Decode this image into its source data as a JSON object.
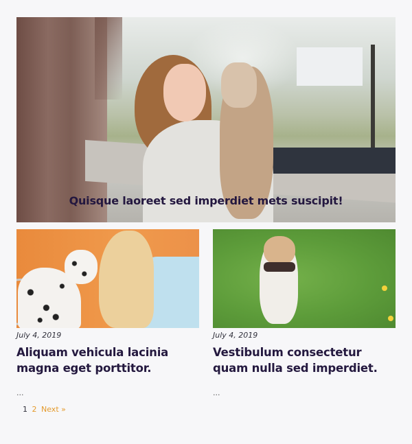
{
  "featured": {
    "caption": "Quisque laoreet sed imperdiet mets suscipit!"
  },
  "posts": [
    {
      "date": "July 4, 2019",
      "title": "Aliquam vehicula lacinia magna eget porttitor.",
      "excerpt": "..."
    },
    {
      "date": "July 4, 2019",
      "title": "Vestibulum consectetur quam nulla sed imperdiet.",
      "excerpt": "..."
    }
  ],
  "pagination": {
    "current": "1",
    "page2": "2",
    "next": "Next »"
  }
}
